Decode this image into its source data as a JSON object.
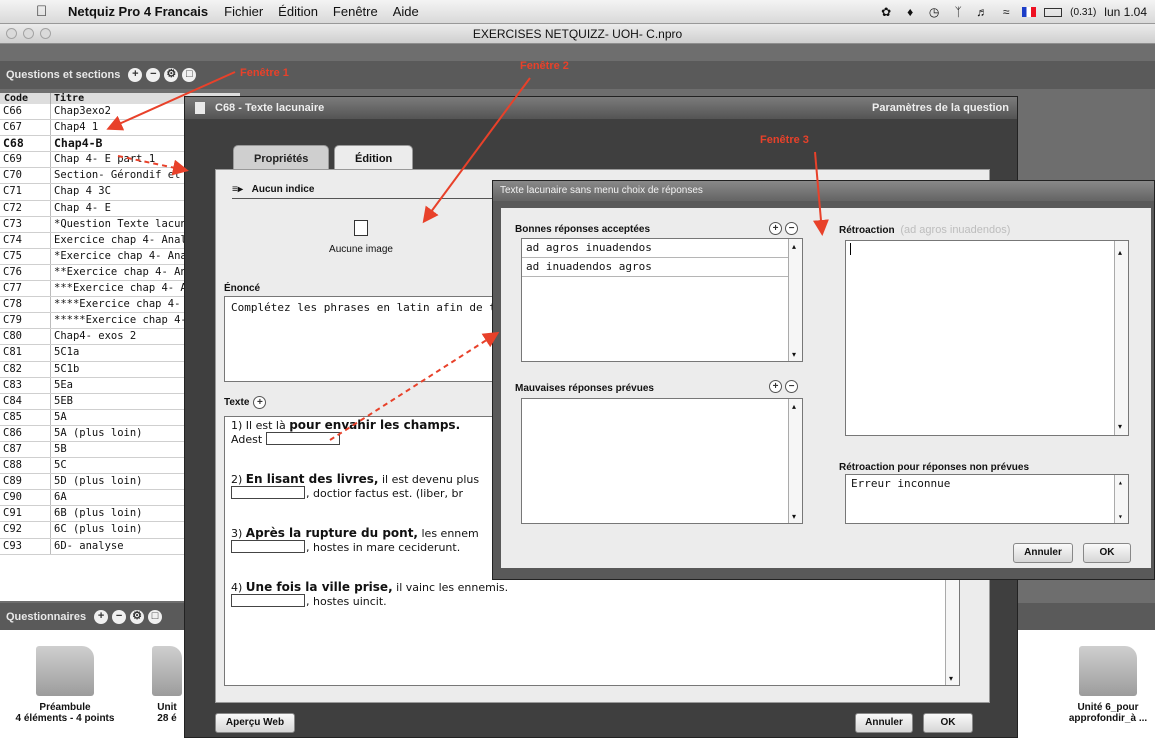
{
  "menubar": {
    "app_name": "Netquiz Pro 4 Francais",
    "items": [
      "Fichier",
      "Édition",
      "Fenêtre",
      "Aide"
    ],
    "battery": "(0.31)",
    "clock": "lun 1.04"
  },
  "document": {
    "title": "EXERCISES NETQUIZZ- UOH- C.npro"
  },
  "questions_panel": {
    "header": "Questions et sections",
    "col_code": "Code",
    "col_title": "Titre",
    "rows": [
      {
        "code": "C66",
        "title": "Chap3exo2"
      },
      {
        "code": "C67",
        "title": "Chap4 1"
      },
      {
        "code": "C68",
        "title": "Chap4-B"
      },
      {
        "code": "C69",
        "title": "Chap 4- E part 1"
      },
      {
        "code": "C70",
        "title": "Section- Gérondif et ad"
      },
      {
        "code": "C71",
        "title": "Chap 4 3C"
      },
      {
        "code": "C72",
        "title": "Chap 4- E"
      },
      {
        "code": "C73",
        "title": "*Question Texte lacun"
      },
      {
        "code": "C74",
        "title": "Exercice chap 4- Analy"
      },
      {
        "code": "C75",
        "title": "*Exercice chap 4- Anal"
      },
      {
        "code": "C76",
        "title": "**Exercice chap 4- An"
      },
      {
        "code": "C77",
        "title": "***Exercice chap 4- A"
      },
      {
        "code": "C78",
        "title": "****Exercice chap 4- /"
      },
      {
        "code": "C79",
        "title": "*****Exercice chap 4-"
      },
      {
        "code": "C80",
        "title": "Chap4- exos 2"
      },
      {
        "code": "C81",
        "title": "5C1a"
      },
      {
        "code": "C82",
        "title": "5C1b"
      },
      {
        "code": "C83",
        "title": "5Ea"
      },
      {
        "code": "C84",
        "title": "5EB"
      },
      {
        "code": "C85",
        "title": "5A"
      },
      {
        "code": "C86",
        "title": "5A (plus loin)"
      },
      {
        "code": "C87",
        "title": "5B"
      },
      {
        "code": "C88",
        "title": "5C"
      },
      {
        "code": "C89",
        "title": "5D (plus loin)"
      },
      {
        "code": "C90",
        "title": "6A"
      },
      {
        "code": "C91",
        "title": "6B (plus loin)"
      },
      {
        "code": "C92",
        "title": "6C (plus loin)"
      },
      {
        "code": "C93",
        "title": "6D- analyse"
      }
    ],
    "selected_code": "C68"
  },
  "questionnaires_panel": {
    "header": "Questionnaires",
    "folders": [
      {
        "name": "Préambule",
        "sub": "4 éléments - 4 points"
      },
      {
        "name": "Unit",
        "sub": "28 é"
      },
      {
        "name": "Unité 6_pour",
        "sub": "approfondir_à ..."
      }
    ]
  },
  "window2": {
    "title": "C68 - Texte lacunaire",
    "params": "Paramètres de la question",
    "tab_props": "Propriétés",
    "tab_edit": "Édition",
    "indice": "Aucun indice",
    "image": "Aucune image",
    "enonce_label": "Énoncé",
    "enonce_text": "Complétez les phrases en latin afin de trad",
    "texte_label": "Texte",
    "texte": [
      {
        "pre": "1) Il est là ",
        "bold": "pour envahir les champs.",
        "post": "",
        "l2_pre": "Adest ",
        "l2_post": ""
      },
      {
        "pre": "2) ",
        "bold": "En lisant des livres,",
        "post": " il est devenu plus",
        "l2_pre": "",
        "l2_post": ", doctior factus est. (liber, br"
      },
      {
        "pre": "3) ",
        "bold": "Après la rupture du pont,",
        "post": " les ennem",
        "l2_pre": "",
        "l2_post": ", hostes in mare ceciderunt."
      },
      {
        "pre": "4) ",
        "bold": "Une fois la ville prise,",
        "post": " il vainc les ennemis.",
        "l2_pre": "",
        "l2_post": ", hostes uincit."
      }
    ],
    "btn_preview": "Aperçu Web",
    "btn_cancel": "Annuler",
    "btn_ok": "OK"
  },
  "window3": {
    "title": "Texte lacunaire sans menu choix de réponses",
    "good_label": "Bonnes réponses acceptées",
    "good_answers": [
      "ad agros inuadendos",
      "ad inuadendos agros"
    ],
    "bad_label": "Mauvaises réponses prévues",
    "feedback_label": "Rétroaction",
    "feedback_hint": "(ad agros inuadendos)",
    "unexpected_label": "Rétroaction pour réponses non prévues",
    "unexpected_text": "Erreur inconnue",
    "btn_cancel": "Annuler",
    "btn_ok": "OK"
  },
  "annotations": {
    "f1": "Fenêtre 1",
    "f2": "Fenêtre 2",
    "f3": "Fenêtre 3"
  },
  "colors": {
    "annotation": "#e8412a",
    "window_dark": "#3f3f3f",
    "panel_header": "#5a5a5a"
  }
}
